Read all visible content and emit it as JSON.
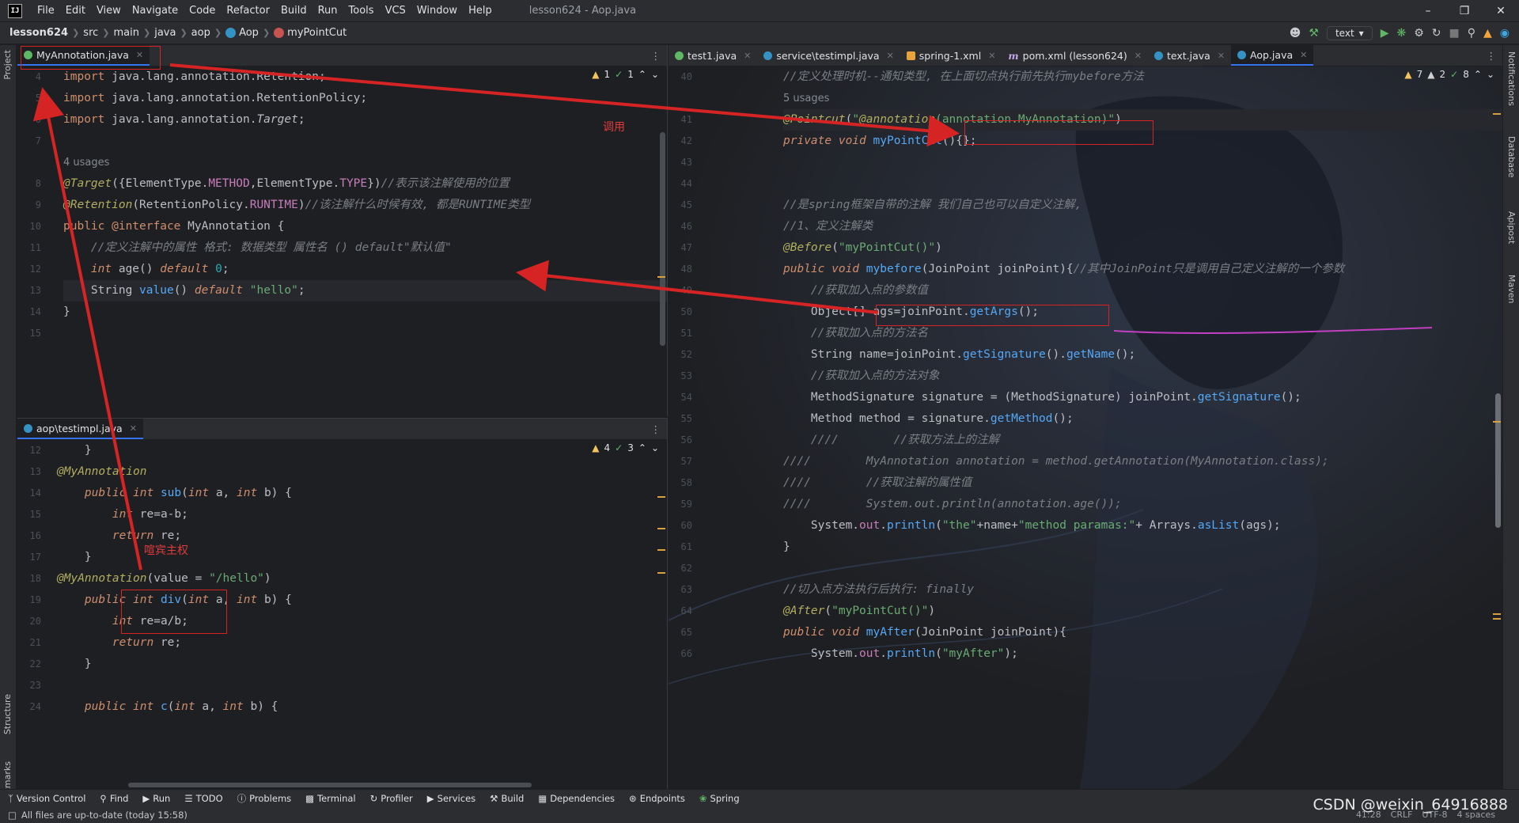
{
  "menu": {
    "logo": "IJ",
    "items": [
      "File",
      "Edit",
      "View",
      "Navigate",
      "Code",
      "Refactor",
      "Build",
      "Run",
      "Tools",
      "VCS",
      "Window",
      "Help"
    ],
    "window_title": "lesson624 - Aop.java"
  },
  "breadcrumb": {
    "project": "lesson624",
    "parts": [
      "src",
      "main",
      "java",
      "aop",
      "Aop",
      "myPointCut"
    ]
  },
  "run_config": "text",
  "left_strip": {
    "project": "Project",
    "structure": "Structure",
    "bookmarks": "Bookmarks"
  },
  "right_strip": {
    "notifications": "Notifications",
    "database": "Database",
    "apipost": "Apipost",
    "maven": "Maven"
  },
  "left_top": {
    "tab": "MyAnnotation.java",
    "inspections": {
      "warnings": "1",
      "ok": "1"
    },
    "lines": [
      {
        "n": "4",
        "code": [
          [
            "kw",
            "import "
          ],
          [
            "typ",
            "java.lang.annotation.Retention;"
          ]
        ]
      },
      {
        "n": "5",
        "code": [
          [
            "kw",
            "import "
          ],
          [
            "typ",
            "java.lang.annotation.RetentionPolicy;"
          ]
        ]
      },
      {
        "n": "6",
        "code": [
          [
            "kw",
            "import "
          ],
          [
            "typ",
            "java.lang.annotation."
          ],
          [
            "itl",
            "Target"
          ],
          [
            "typ",
            ";"
          ]
        ]
      },
      {
        "n": "7",
        "code": []
      },
      {
        "n": "",
        "code": [
          [
            "usage",
            "4 usages"
          ]
        ]
      },
      {
        "n": "8",
        "code": [
          [
            "ann",
            "@Target"
          ],
          [
            "typ",
            "({ElementType."
          ],
          [
            "fld",
            "METHOD"
          ],
          [
            "typ",
            ",ElementType."
          ],
          [
            "fld",
            "TYPE"
          ],
          [
            "typ",
            "})"
          ],
          [
            "cmt",
            "//表示该注解使用的位置"
          ]
        ]
      },
      {
        "n": "9",
        "code": [
          [
            "ann",
            "@Retention"
          ],
          [
            "typ",
            "(RetentionPolicy."
          ],
          [
            "fld",
            "RUNTIME"
          ],
          [
            "typ",
            ")"
          ],
          [
            "cmt",
            "//该注解什么时候有效, 都是RUNTIME类型"
          ]
        ]
      },
      {
        "n": "10",
        "code": [
          [
            "kw",
            "public "
          ],
          [
            "kw",
            "@interface "
          ],
          [
            "cls",
            "MyAnnotation "
          ],
          [
            "typ",
            "{"
          ]
        ]
      },
      {
        "n": "11",
        "code": [
          [
            "typ",
            "    "
          ],
          [
            "cmt",
            "//定义注解中的属性 格式: 数据类型 属性名 () default\"默认值\""
          ]
        ]
      },
      {
        "n": "12",
        "code": [
          [
            "typ",
            "    "
          ],
          [
            "kwi",
            "int "
          ],
          [
            "typ",
            "age() "
          ],
          [
            "kwi",
            "default "
          ],
          [
            "num",
            "0"
          ],
          [
            "typ",
            ";"
          ]
        ]
      },
      {
        "n": "13",
        "code": [
          [
            "typ",
            "    String "
          ],
          [
            "fn",
            "value"
          ],
          [
            "typ",
            "() "
          ],
          [
            "kwi",
            "default "
          ],
          [
            "str",
            "\"hello\""
          ],
          [
            "typ",
            ";"
          ]
        ]
      },
      {
        "n": "14",
        "code": [
          [
            "typ",
            "}"
          ]
        ]
      },
      {
        "n": "15",
        "code": []
      }
    ]
  },
  "left_bottom": {
    "tab": "aop\\testimpl.java",
    "inspections": {
      "warnings": "4",
      "ok": "3"
    },
    "lines": [
      {
        "n": "12",
        "code": [
          [
            "typ",
            "    }"
          ]
        ]
      },
      {
        "n": "13",
        "code": [
          [
            "ann",
            "@MyAnnotation"
          ]
        ]
      },
      {
        "n": "14",
        "code": [
          [
            "typ",
            "    "
          ],
          [
            "kwi",
            "public int "
          ],
          [
            "fn",
            "sub"
          ],
          [
            "typ",
            "("
          ],
          [
            "kwi",
            "int "
          ],
          [
            "typ",
            "a, "
          ],
          [
            "kwi",
            "int "
          ],
          [
            "typ",
            "b) {"
          ]
        ]
      },
      {
        "n": "15",
        "code": [
          [
            "typ",
            "        "
          ],
          [
            "kwi",
            "int "
          ],
          [
            "typ",
            "re=a-b;"
          ]
        ]
      },
      {
        "n": "16",
        "code": [
          [
            "typ",
            "        "
          ],
          [
            "kwi",
            "return "
          ],
          [
            "typ",
            "re;"
          ]
        ]
      },
      {
        "n": "17",
        "code": [
          [
            "typ",
            "    }"
          ]
        ]
      },
      {
        "n": "18",
        "code": [
          [
            "ann",
            "@MyAnnotation"
          ],
          [
            "typ",
            "(value = "
          ],
          [
            "str",
            "\"/hello\""
          ],
          [
            "typ",
            ")"
          ]
        ]
      },
      {
        "n": "19",
        "code": [
          [
            "typ",
            "    "
          ],
          [
            "kwi",
            "public int "
          ],
          [
            "fn",
            "div"
          ],
          [
            "typ",
            "("
          ],
          [
            "kwi",
            "int "
          ],
          [
            "typ",
            "a, "
          ],
          [
            "kwi",
            "int "
          ],
          [
            "typ",
            "b) {"
          ]
        ]
      },
      {
        "n": "20",
        "code": [
          [
            "typ",
            "        "
          ],
          [
            "kwi",
            "int "
          ],
          [
            "typ",
            "re=a/b;"
          ]
        ]
      },
      {
        "n": "21",
        "code": [
          [
            "typ",
            "        "
          ],
          [
            "kwi",
            "return "
          ],
          [
            "typ",
            "re;"
          ]
        ]
      },
      {
        "n": "22",
        "code": [
          [
            "typ",
            "    }"
          ]
        ]
      },
      {
        "n": "23",
        "code": []
      },
      {
        "n": "24",
        "code": [
          [
            "typ",
            "    "
          ],
          [
            "kwi",
            "public int "
          ],
          [
            "fn",
            "c"
          ],
          [
            "typ",
            "("
          ],
          [
            "kwi",
            "int "
          ],
          [
            "typ",
            "a, "
          ],
          [
            "kwi",
            "int "
          ],
          [
            "typ",
            "b) {"
          ]
        ]
      }
    ]
  },
  "right": {
    "tabs": [
      "test1.java",
      "service\\testimpl.java",
      "spring-1.xml",
      "pom.xml (lesson624)",
      "text.java",
      "Aop.java"
    ],
    "inspections": {
      "warnings": "7",
      "weak": "2",
      "ok": "8"
    },
    "lines": [
      {
        "n": "40",
        "code": [
          [
            "cmt",
            "//定义处理时机--通知类型, 在上面切点执行前先执行mybefore方法"
          ]
        ]
      },
      {
        "n": "",
        "code": [
          [
            "usage",
            "5 usages"
          ]
        ]
      },
      {
        "n": "41",
        "code": [
          [
            "ann",
            "@Pointcut"
          ],
          [
            "typ",
            "("
          ],
          [
            "str",
            "\""
          ],
          [
            "ann",
            "@annotation"
          ],
          [
            "str",
            "("
          ],
          [
            "str",
            "annotation.MyAnnotation"
          ],
          [
            "str",
            ")\""
          ],
          [
            "typ",
            ")"
          ]
        ]
      },
      {
        "n": "42",
        "code": [
          [
            "kwi",
            "private void "
          ],
          [
            "fn",
            "myPointCut"
          ],
          [
            "typ",
            "(){};"
          ]
        ]
      },
      {
        "n": "43",
        "code": []
      },
      {
        "n": "44",
        "code": []
      },
      {
        "n": "45",
        "code": [
          [
            "cmt",
            "//是spring框架自带的注解 我们自己也可以自定义注解,"
          ]
        ]
      },
      {
        "n": "46",
        "code": [
          [
            "cmt",
            "//1、定义注解类"
          ]
        ]
      },
      {
        "n": "47",
        "code": [
          [
            "ann",
            "@Before"
          ],
          [
            "typ",
            "("
          ],
          [
            "str",
            "\"myPointCut()\""
          ],
          [
            "typ",
            ")"
          ]
        ]
      },
      {
        "n": "48",
        "code": [
          [
            "kwi",
            "public void "
          ],
          [
            "fn",
            "mybefore"
          ],
          [
            "typ",
            "(JoinPoint joinPoint){"
          ],
          [
            "cmt",
            "//其中JoinPoint只是调用自己定义注解的一个参数"
          ]
        ]
      },
      {
        "n": "49",
        "code": [
          [
            "typ",
            "    "
          ],
          [
            "cmt",
            "//获取加入点的参数值"
          ]
        ]
      },
      {
        "n": "50",
        "code": [
          [
            "typ",
            "    Object[] ags=joinPoint."
          ],
          [
            "fn",
            "getArgs"
          ],
          [
            "typ",
            "();"
          ]
        ]
      },
      {
        "n": "51",
        "code": [
          [
            "typ",
            "    "
          ],
          [
            "cmt",
            "//获取加入点的方法名"
          ]
        ]
      },
      {
        "n": "52",
        "code": [
          [
            "typ",
            "    String name=joinPoint."
          ],
          [
            "fn",
            "getSignature"
          ],
          [
            "typ",
            "()."
          ],
          [
            "fn",
            "getName"
          ],
          [
            "typ",
            "();"
          ]
        ]
      },
      {
        "n": "53",
        "code": [
          [
            "typ",
            "    "
          ],
          [
            "cmt",
            "//获取加入点的方法对象"
          ]
        ]
      },
      {
        "n": "54",
        "code": [
          [
            "typ",
            "    MethodSignature signature = (MethodSignature) joinPoint."
          ],
          [
            "fn",
            "getSignature"
          ],
          [
            "typ",
            "();"
          ]
        ]
      },
      {
        "n": "55",
        "code": [
          [
            "typ",
            "    Method method = signature."
          ],
          [
            "fn",
            "getMethod"
          ],
          [
            "typ",
            "();"
          ]
        ]
      },
      {
        "n": "56",
        "code": [
          [
            "typ",
            "    "
          ],
          [
            "cmt",
            "////        //获取方法上的注解"
          ]
        ]
      },
      {
        "n": "57",
        "code": [
          [
            "cmt",
            "////        MyAnnotation annotation = method.getAnnotation(MyAnnotation.class);"
          ]
        ]
      },
      {
        "n": "58",
        "code": [
          [
            "cmt",
            "////        //获取注解的属性值"
          ]
        ]
      },
      {
        "n": "59",
        "code": [
          [
            "cmt",
            "////        System.out.println(annotation.age());"
          ]
        ]
      },
      {
        "n": "60",
        "code": [
          [
            "typ",
            "    System."
          ],
          [
            "fld",
            "out"
          ],
          [
            "typ",
            "."
          ],
          [
            "fn",
            "println"
          ],
          [
            "typ",
            "("
          ],
          [
            "str",
            "\"the\""
          ],
          [
            "typ",
            "+name+"
          ],
          [
            "str",
            "\"method paramas:\""
          ],
          [
            "typ",
            "+ Arrays."
          ],
          [
            "fn",
            "asList"
          ],
          [
            "typ",
            "(ags);"
          ]
        ]
      },
      {
        "n": "61",
        "code": [
          [
            "typ",
            "}"
          ]
        ]
      },
      {
        "n": "62",
        "code": []
      },
      {
        "n": "63",
        "code": [
          [
            "cmt",
            "//切入点方法执行后执行: finally"
          ]
        ]
      },
      {
        "n": "64",
        "code": [
          [
            "ann",
            "@After"
          ],
          [
            "typ",
            "("
          ],
          [
            "str",
            "\"myPointCut()\""
          ],
          [
            "typ",
            ")"
          ]
        ]
      },
      {
        "n": "65",
        "code": [
          [
            "kwi",
            "public void "
          ],
          [
            "fn",
            "myAfter"
          ],
          [
            "typ",
            "(JoinPoint joinPoint){"
          ]
        ]
      },
      {
        "n": "66",
        "code": [
          [
            "typ",
            "    System."
          ],
          [
            "fld",
            "out"
          ],
          [
            "typ",
            "."
          ],
          [
            "fn",
            "println"
          ],
          [
            "typ",
            "("
          ],
          [
            "str",
            "\"myAfter\""
          ],
          [
            "typ",
            ");"
          ]
        ]
      }
    ]
  },
  "annotations": {
    "call": "调用",
    "slave": "喧宾主权"
  },
  "bottom_tools": [
    "Version Control",
    "Find",
    "Run",
    "TODO",
    "Problems",
    "Terminal",
    "Profiler",
    "Services",
    "Build",
    "Dependencies",
    "Endpoints",
    "Spring"
  ],
  "status": {
    "message": "All files are up-to-date (today 15:58)",
    "position": "41:28",
    "line_sep": "CRLF",
    "encoding": "UTF-8",
    "indent": "4 spaces"
  },
  "watermark": "CSDN @weixin_64916888",
  "colors": {
    "accent": "#3574f0",
    "annotation_red": "#d62424"
  }
}
